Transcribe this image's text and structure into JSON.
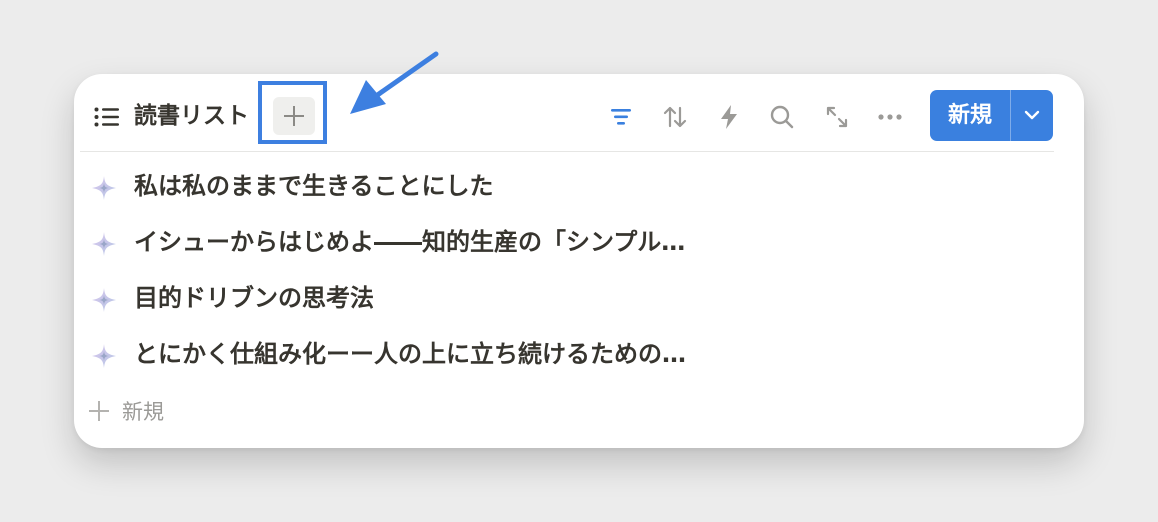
{
  "database": {
    "title": "読書リスト",
    "view_type_icon": "list-icon",
    "add_view_icon": "plus-icon"
  },
  "toolbar": {
    "icons": [
      "filter-icon",
      "sort-icon",
      "automation-icon",
      "search-icon",
      "expand-icon",
      "more-icon"
    ],
    "new_label": "新規",
    "new_dropdown_icon": "chevron-down-icon",
    "filter_color": "#3a80df"
  },
  "rows": [
    {
      "title": "私は私のままで生きることにした",
      "icon": "sparkle-icon"
    },
    {
      "title": "イシューからはじめよ――知的生産の「シンプル…",
      "icon": "sparkle-icon"
    },
    {
      "title": "目的ドリブンの思考法",
      "icon": "sparkle-icon"
    },
    {
      "title": "とにかく仕組み化ーー人の上に立ち続けるための…",
      "icon": "sparkle-icon"
    }
  ],
  "add_row": {
    "label": "新規",
    "icon": "plus-icon"
  },
  "annotation": {
    "highlight_color": "#3d7fe0",
    "arrow_icon": "arrow-icon"
  }
}
